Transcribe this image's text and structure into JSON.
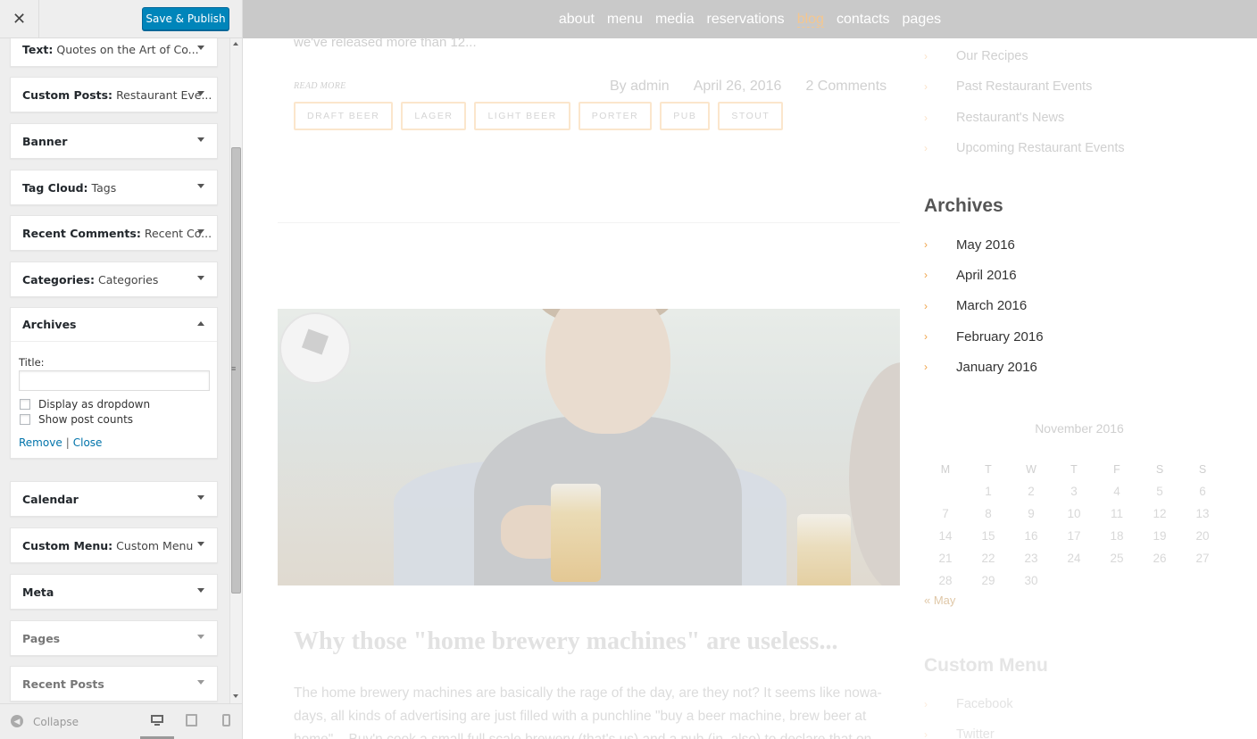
{
  "customizer": {
    "close_icon": "✕",
    "save_label": "Save & Publish",
    "widgets": [
      {
        "type": "Text:",
        "title": "Quotes on the Art of Co...",
        "arrow": "down"
      },
      {
        "type": "Custom Posts:",
        "title": "Restaurant Eve...",
        "arrow": "down"
      },
      {
        "type": "Banner",
        "title": "",
        "arrow": "down"
      },
      {
        "type": "Tag Cloud:",
        "title": "Tags",
        "arrow": "down"
      },
      {
        "type": "Recent Comments:",
        "title": "Recent Co...",
        "arrow": "down"
      },
      {
        "type": "Categories:",
        "title": "Categories",
        "arrow": "down"
      },
      {
        "type": "Archives",
        "title": "",
        "arrow": "up"
      },
      {
        "type": "Calendar",
        "title": "",
        "arrow": "down"
      },
      {
        "type": "Custom Menu:",
        "title": "Custom Menu",
        "arrow": "down"
      },
      {
        "type": "Meta",
        "title": "",
        "arrow": "down"
      },
      {
        "type": "Pages",
        "title": "",
        "arrow": "down"
      },
      {
        "type": "Recent Posts",
        "title": "",
        "arrow": "down"
      }
    ],
    "archives_form": {
      "title_label": "Title:",
      "title_value": "",
      "dropdown_label": "Display as dropdown",
      "dropdown_checked": false,
      "postcounts_label": "Show post counts",
      "postcounts_checked": false,
      "remove_link": "Remove",
      "separator": "|",
      "close_link": "Close"
    },
    "footer": {
      "collapse_label": "Collapse",
      "devices": [
        "desktop",
        "tablet",
        "mobile"
      ],
      "active_device": "desktop"
    }
  },
  "preview": {
    "nav": [
      {
        "label": "about",
        "active": false
      },
      {
        "label": "menu",
        "active": false
      },
      {
        "label": "media",
        "active": false
      },
      {
        "label": "reservations",
        "active": false
      },
      {
        "label": "blog",
        "active": true
      },
      {
        "label": "contacts",
        "active": false
      },
      {
        "label": "pages",
        "active": false
      }
    ],
    "post1": {
      "excerpt": "we've released more than 12...",
      "read_more": "READ MORE",
      "author": "By admin",
      "date": "April 26, 2016",
      "comments": "2 Comments",
      "tags": [
        "DRAFT BEER",
        "LAGER",
        "LIGHT BEER",
        "PORTER",
        "PUB",
        "STOUT"
      ]
    },
    "post2": {
      "title": "Why those \"home brewery machines\" are useless...",
      "body": "The home brewery machines are basically the rage of the day, are they not? It seems like nowa-days, all kinds of advertising are just filled with a punchline \"buy a beer machine, brew beer at home\"... Buy'n cook a small full scale brewery (that's us) and a pub (in, also) to declare that on"
    },
    "sidebar": {
      "categories": [
        "Our Recipes",
        "Past Restaurant Events",
        "Restaurant's News",
        "Upcoming Restaurant Events"
      ],
      "archives_title": "Archives",
      "archives": [
        "May 2016",
        "April 2016",
        "March 2016",
        "February 2016",
        "January 2016"
      ],
      "calendar": {
        "caption": "November 2016",
        "days": [
          "M",
          "T",
          "W",
          "T",
          "F",
          "S",
          "S"
        ],
        "rows": [
          [
            "",
            "1",
            "2",
            "3",
            "4",
            "5",
            "6"
          ],
          [
            "7",
            "8",
            "9",
            "10",
            "11",
            "12",
            "13"
          ],
          [
            "14",
            "15",
            "16",
            "17",
            "18",
            "19",
            "20"
          ],
          [
            "21",
            "22",
            "23",
            "24",
            "25",
            "26",
            "27"
          ],
          [
            "28",
            "29",
            "30",
            "",
            "",
            "",
            ""
          ]
        ],
        "prev_link": "« May"
      },
      "custom_menu_title": "Custom Menu",
      "custom_menu": [
        "Facebook",
        "Twitter"
      ]
    }
  }
}
